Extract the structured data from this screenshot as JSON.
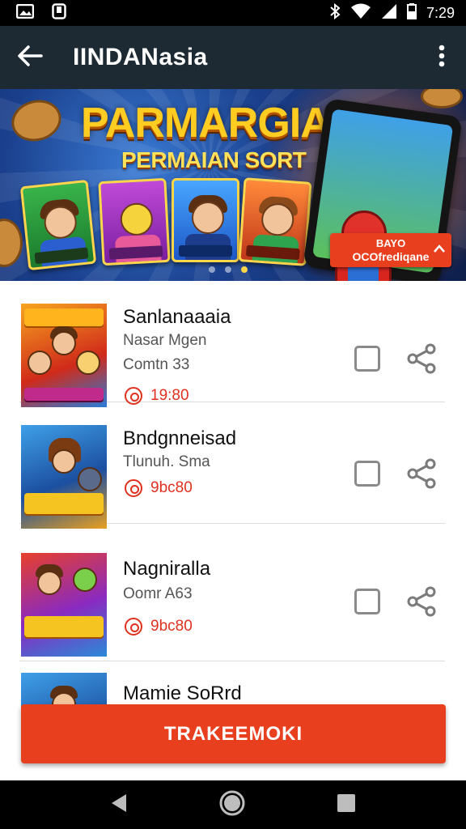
{
  "status_bar": {
    "time": "7:29",
    "left_icons": [
      "gallery-icon",
      "notification-icon"
    ],
    "right_icons": [
      "bluetooth-icon",
      "wifi-icon",
      "signal-icon",
      "battery-icon"
    ]
  },
  "app_bar": {
    "title": "IINDANasia",
    "back_icon": "arrow-back-icon",
    "menu_icon": "more-vertical-icon"
  },
  "banner": {
    "title": "PARMARGIAI",
    "subtitle": "PERMAIAN SORT",
    "badge_line1": "BAYO",
    "badge_line2": "OCOfrediqane",
    "active_dot": 1,
    "dot_count": 3
  },
  "list": {
    "items": [
      {
        "name": "Sanlanaaaia",
        "line1": "Nasar Mgen",
        "line2": "Comtn 33",
        "price": "19:80"
      },
      {
        "name": "Bndgnneisad",
        "line1": "Tlunuh. Sma",
        "line2": "",
        "price": "9bc80"
      },
      {
        "name": "Nagniralla",
        "line1": "Oomr A63",
        "line2": "",
        "price": "9bc80"
      },
      {
        "name": "Mamie SoRrd",
        "line1": "",
        "line2": "",
        "price": ""
      }
    ]
  },
  "primary_button": {
    "label": "TRAKEEMOKI"
  },
  "nav_bar": {
    "icons": [
      "back-triangle-icon",
      "home-circle-icon",
      "recents-square-icon"
    ]
  },
  "colors": {
    "accent": "#e8401f",
    "app_bar": "#1e2a33",
    "price": "#e0301e"
  }
}
